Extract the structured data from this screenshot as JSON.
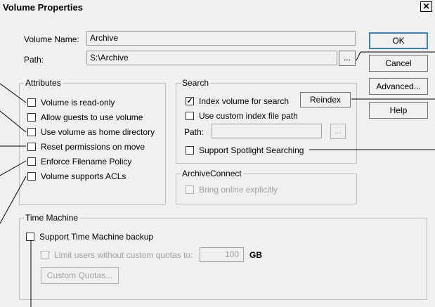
{
  "window": {
    "title": "Volume Properties",
    "close_glyph": "✕"
  },
  "general": {
    "volume_name_label": "Volume Name:",
    "volume_name_value": "Archive",
    "path_label": "Path:",
    "path_value": "S:\\Archive",
    "browse_label": "..."
  },
  "buttons": {
    "ok": "OK",
    "cancel": "Cancel",
    "advanced": "Advanced...",
    "help": "Help"
  },
  "attributes": {
    "title": "Attributes",
    "items": [
      {
        "label": "Volume is read-only",
        "checked": false
      },
      {
        "label": "Allow guests to use volume",
        "checked": false
      },
      {
        "label": "Use volume as home directory",
        "checked": false
      },
      {
        "label": "Reset permissions on move",
        "checked": false
      },
      {
        "label": "Enforce Filename Policy",
        "checked": false
      },
      {
        "label": "Volume supports ACLs",
        "checked": false
      }
    ]
  },
  "search": {
    "title": "Search",
    "index_label": "Index volume for search",
    "index_check": "✓",
    "reindex_label": "Reindex",
    "custom_index_label": "Use custom index file path",
    "path_label": "Path:",
    "path_value": "",
    "browse_label": "...",
    "spotlight_label": "Support Spotlight Searching"
  },
  "archiveconnect": {
    "title": "ArchiveConnect",
    "bring_online_label": "Bring online explicitly"
  },
  "time_machine": {
    "title": "Time Machine",
    "support_label": "Support Time Machine backup",
    "limit_label": "Limit users without custom quotas to:",
    "limit_value": "100",
    "unit": "GB",
    "custom_quotas_label": "Custom Quotas..."
  },
  "colors": {
    "dialog_bg": "#f0f0f0",
    "default_button_border": "#3c7fb1",
    "disabled_text": "#a0a0a0"
  }
}
